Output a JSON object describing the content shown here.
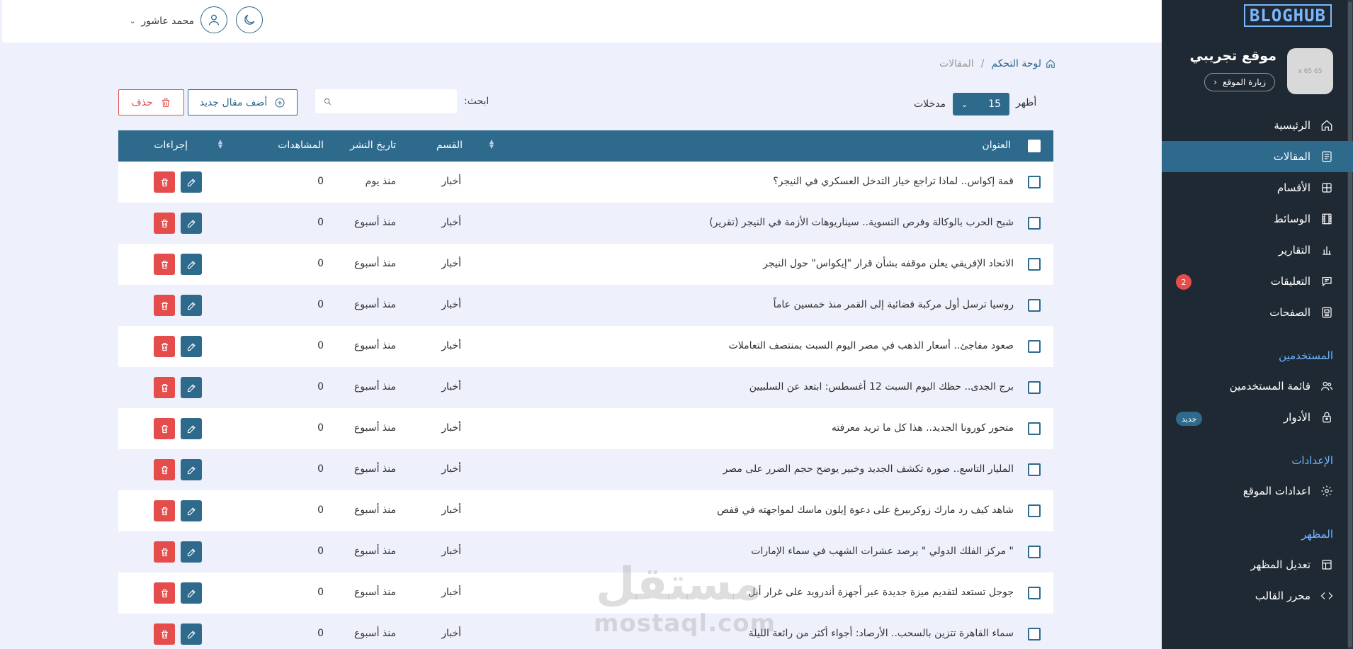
{
  "brand": "BLOGHUB",
  "site": {
    "name": "موقع تجريبي",
    "visit_label": "زيارة الموقع",
    "thumb_label": "65 x 65"
  },
  "nav": {
    "home": "الرئيسية",
    "articles": "المقالات",
    "categories": "الأقسام",
    "media": "الوسائط",
    "reports": "التقارير",
    "comments": "التعليقات",
    "comments_badge": "2",
    "pages": "الصفحات",
    "users_section": "المستخدمين",
    "users_list": "قائمة المستخدمين",
    "roles": "الأدوار",
    "roles_badge": "جديد",
    "settings_section": "الإعدادات",
    "site_settings": "اعدادات الموقع",
    "appearance_section": "المظهر",
    "edit_appearance": "تعديل المظهر",
    "template_editor": "محرر القالب"
  },
  "user": {
    "name": "محمد عاشور"
  },
  "breadcrumb": {
    "home": "لوحة التحكم",
    "separator": "/",
    "current": "المقالات"
  },
  "controls": {
    "show_label": "أظهر",
    "page_size": "15",
    "entries_label": "مدخلات",
    "search_label": "ابحث:",
    "search_placeholder": "",
    "add_label": "أضف مقال جديد",
    "delete_label": "حذف"
  },
  "table": {
    "headers": {
      "title": "العنوان",
      "category": "القسم",
      "date": "تاريخ النشر",
      "views": "المشاهدات",
      "actions": "إجراءات"
    },
    "rows": [
      {
        "title": "قمة إكواس.. لماذا تراجع خيار التدخل العسكري في النيجر؟",
        "category": "أخبار",
        "date": "منذ يوم",
        "views": "0"
      },
      {
        "title": "شبح الحرب بالوكالة وفرص التسوية.. سيناريوهات الأزمة في النيجر (تقرير)",
        "category": "أخبار",
        "date": "منذ أسبوع",
        "views": "0"
      },
      {
        "title": "الاتحاد الإفريقي يعلن موقفه بشأن قرار \"إيكواس\" حول النيجر",
        "category": "أخبار",
        "date": "منذ أسبوع",
        "views": "0"
      },
      {
        "title": "روسيا ترسل أول مركبة فضائية إلى القمر منذ خمسين عاماً",
        "category": "أخبار",
        "date": "منذ أسبوع",
        "views": "0"
      },
      {
        "title": "صعود مفاجئ.. أسعار الذهب في مصر اليوم السبت بمنتصف التعاملات",
        "category": "أخبار",
        "date": "منذ أسبوع",
        "views": "0"
      },
      {
        "title": "برج الجدى.. حظك اليوم السبت 12 أغسطس: ابتعد عن السلبيين",
        "category": "أخبار",
        "date": "منذ أسبوع",
        "views": "0"
      },
      {
        "title": "متحور كورونا الجديد.. هذا كل ما تريد معرفته",
        "category": "أخبار",
        "date": "منذ أسبوع",
        "views": "0"
      },
      {
        "title": "المليار التاسع.. صورة تكشف الجديد وخبير يوضح حجم الضرر على مصر",
        "category": "أخبار",
        "date": "منذ أسبوع",
        "views": "0"
      },
      {
        "title": "شاهد كيف رد مارك زوكربيرغ على دعوة إيلون ماسك لمواجهته في قفص",
        "category": "أخبار",
        "date": "منذ أسبوع",
        "views": "0"
      },
      {
        "title": "\" مركز الفلك الدولي \" يرصد عشرات الشهب في سماء الإمارات",
        "category": "أخبار",
        "date": "منذ أسبوع",
        "views": "0"
      },
      {
        "title": "جوجل تستعد لتقديم ميزة جديدة عبر أجهزة أندرويد على غرار أبل",
        "category": "أخبار",
        "date": "منذ أسبوع",
        "views": "0"
      },
      {
        "title": "سماء القاهرة تتزين بالسحب.. الأرصاد: أجواء أكثر من رائعة الليلة",
        "category": "أخبار",
        "date": "منذ أسبوع",
        "views": "0"
      }
    ]
  },
  "watermark": {
    "ar": "مستقل",
    "en": "mostaql.com"
  }
}
